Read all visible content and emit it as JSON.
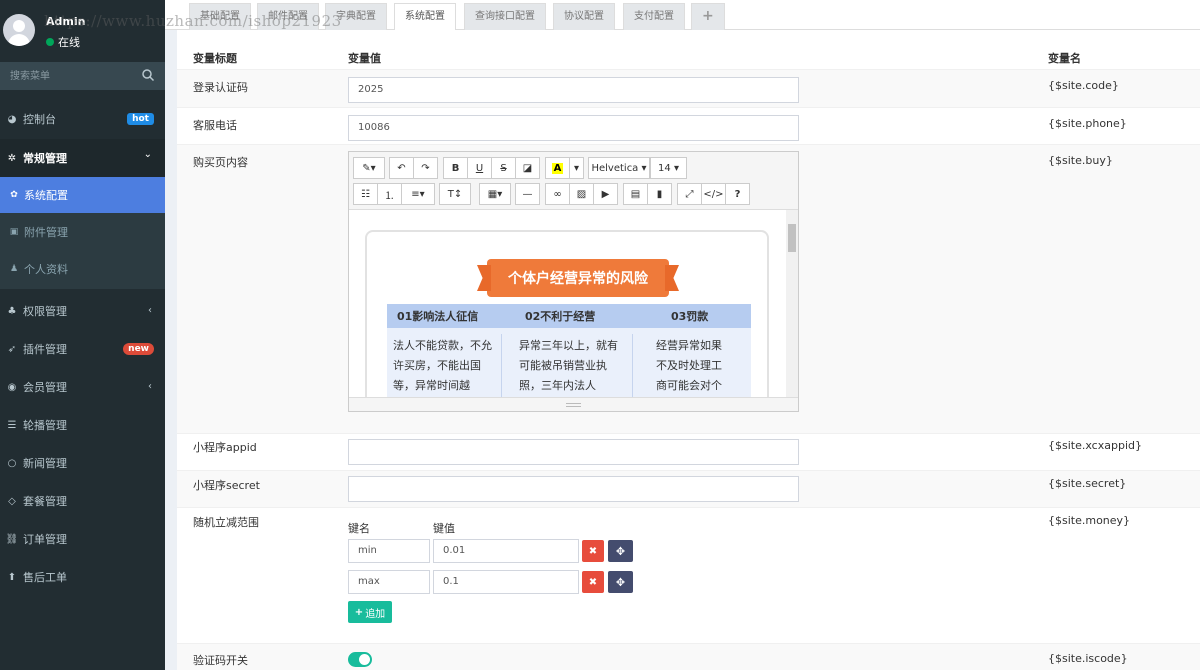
{
  "user": {
    "name": "Admin",
    "status": "在线"
  },
  "watermark": "https://www.huzhan.com/ishop21923",
  "search": {
    "placeholder": "搜索菜单"
  },
  "menu": [
    {
      "label": "控制台",
      "icon": "dashboard-icon",
      "badge": "hot"
    },
    {
      "label": "常规管理",
      "icon": "cogs-icon",
      "chevron": "⌄"
    },
    {
      "label": "权限管理",
      "icon": "group-icon",
      "chevron": "‹"
    },
    {
      "label": "插件管理",
      "icon": "rocket-icon",
      "badge": "new"
    },
    {
      "label": "会员管理",
      "icon": "user-circle-icon",
      "chevron": "‹"
    },
    {
      "label": "轮播管理",
      "icon": "list-icon"
    },
    {
      "label": "新闻管理",
      "icon": "circle-o-icon"
    },
    {
      "label": "套餐管理",
      "icon": "diamond-icon"
    },
    {
      "label": "订单管理",
      "icon": "sitemap-icon"
    },
    {
      "label": "售后工单",
      "icon": "arrow-up-icon"
    }
  ],
  "submenu": [
    {
      "label": "系统配置",
      "icon": "cog-icon"
    },
    {
      "label": "附件管理",
      "icon": "file-image-icon"
    },
    {
      "label": "个人资料",
      "icon": "user-icon"
    }
  ],
  "tabs": [
    "基础配置",
    "邮件配置",
    "字典配置",
    "系统配置",
    "查询接口配置",
    "协议配置",
    "支付配置",
    "+"
  ],
  "table": {
    "headers": {
      "title": "变量标题",
      "value": "变量值",
      "name": "变量名"
    },
    "rows": {
      "code": {
        "title": "登录认证码",
        "value": "2025",
        "var": "{$site.code}"
      },
      "phone": {
        "title": "客服电话",
        "value": "10086",
        "var": "{$site.phone}"
      },
      "buy": {
        "title": "购买页内容",
        "var": "{$site.buy}"
      },
      "xcxappid": {
        "title": "小程序appid",
        "value": "",
        "var": "{$site.xcxappid}"
      },
      "secret": {
        "title": "小程序secret",
        "value": "",
        "var": "{$site.secret}"
      },
      "money": {
        "title": "随机立减范围",
        "var": "{$site.money}"
      },
      "iscode": {
        "title": "验证码开关",
        "var": "{$site.iscode}"
      }
    }
  },
  "editor": {
    "font": "Helvetica",
    "size": "14",
    "poster": {
      "title": "个体户经营异常的风险",
      "columns": [
        {
          "head": "01影响法人征信",
          "text": "法人不能贷款，不允许买房，不能出国等，异常时间越"
        },
        {
          "head": "02不利于经营",
          "text": "异常三年以上，就有可能被吊销营业执照，三年内法人"
        },
        {
          "head": "03罚款",
          "text": "经营异常如果不及时处理工商可能会对个"
        }
      ]
    }
  },
  "kv": {
    "key_label": "键名",
    "value_label": "键值",
    "items": [
      {
        "key": "min",
        "value": "0.01"
      },
      {
        "key": "max",
        "value": "0.1"
      }
    ],
    "add_label": "追加",
    "add_icon": "+"
  },
  "toggle": {
    "on": true
  }
}
